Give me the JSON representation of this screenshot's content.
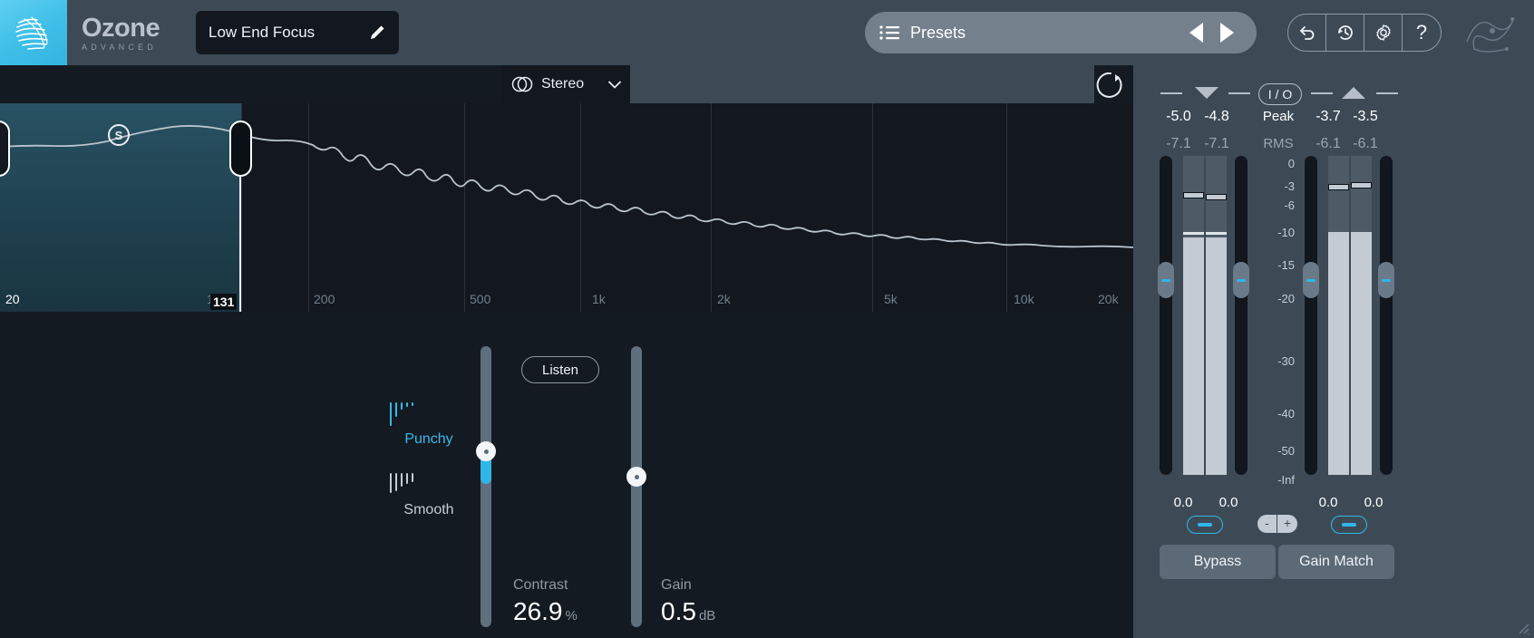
{
  "header": {
    "brand_name": "Ozone",
    "brand_sub": "ADVANCED",
    "preset_name": "Low End Focus",
    "edit_icon": "pencil-icon",
    "logo_icon": "ozone-sphere-logo",
    "presets": {
      "label": "Presets",
      "list_icon": "list-icon",
      "prev_icon": "triangle-left-icon",
      "next_icon": "triangle-right-icon"
    },
    "utilities": [
      {
        "name": "undo-button",
        "icon": "undo-arrow-icon"
      },
      {
        "name": "history-button",
        "icon": "history-clock-icon"
      },
      {
        "name": "settings-button",
        "icon": "gear-icon"
      },
      {
        "name": "help-button",
        "icon": "question-mark-icon",
        "glyph": "?"
      }
    ],
    "waveform_icon": "scribble-waveform-icon"
  },
  "module_strip": {
    "stereo_mode": "Stereo",
    "stereo_icon": "stereo-circles-icon",
    "chevron_icon": "chevron-down-icon",
    "reset_icon": "reset-circle-arrow-icon"
  },
  "spectrum": {
    "frequency_labels": [
      "20",
      "100",
      "200",
      "500",
      "1k",
      "2k",
      "5k",
      "10k",
      "20k"
    ],
    "crossover_value": "131",
    "solo_badge": "S",
    "band_color": "#31687e"
  },
  "controls": {
    "listen_label": "Listen",
    "modes": [
      {
        "name": "punchy",
        "label": "Punchy",
        "icon": "punchy-bars-icon",
        "active": true,
        "color": "#39b9e8"
      },
      {
        "name": "smooth",
        "label": "Smooth",
        "icon": "smooth-bars-icon",
        "active": false,
        "color": "#c4cdd6"
      }
    ],
    "contrast": {
      "label": "Contrast",
      "value": "26.9",
      "unit": "%"
    },
    "gain": {
      "label": "Gain",
      "value": "0.5",
      "unit": "dB"
    }
  },
  "meters": {
    "io_label": "I / O",
    "peak_label": "Peak",
    "rms_label": "RMS",
    "input": {
      "peak": [
        "-5.0",
        "-4.8"
      ],
      "rms": [
        "-7.1",
        "-7.1"
      ],
      "gain": [
        "0.0",
        "0.0"
      ],
      "arrow_icon": "arrow-down-icon"
    },
    "output": {
      "peak": [
        "-3.7",
        "-3.5"
      ],
      "rms": [
        "-6.1",
        "-6.1"
      ],
      "gain": [
        "0.0",
        "0.0"
      ],
      "arrow_icon": "arrow-up-icon"
    },
    "scale": [
      "0",
      "-3",
      "-6",
      "-10",
      "-15",
      "-20",
      "-30",
      "-40",
      "-50",
      "-Inf"
    ],
    "link_icon": "link-icon",
    "minus_label": "-",
    "plus_label": "+",
    "bypass_label": "Bypass",
    "gain_match_label": "Gain Match",
    "accent_color": "#2fb6e9"
  }
}
